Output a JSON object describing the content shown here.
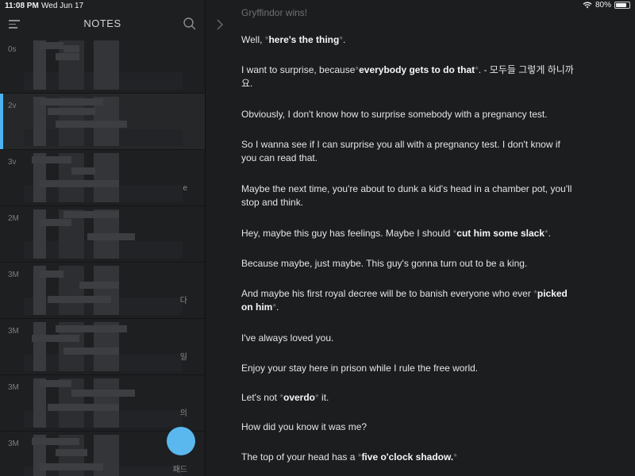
{
  "status": {
    "time": "11:08 PM",
    "date": "Wed Jun 17",
    "battery": "80%",
    "battery_level": 0.8
  },
  "sidebar": {
    "title": "NOTES",
    "items": [
      {
        "meta": "0s",
        "tail": ""
      },
      {
        "meta": "2v",
        "tail": ""
      },
      {
        "meta": "3v",
        "tail": "e"
      },
      {
        "meta": "2M",
        "tail": ""
      },
      {
        "meta": "3M",
        "tail": "다"
      },
      {
        "meta": "3M",
        "tail": "일"
      },
      {
        "meta": "3M",
        "tail": "의"
      },
      {
        "meta": "3M",
        "tail": "패드"
      }
    ]
  },
  "editor": {
    "top_line": "Gryffindor wins!",
    "paragraphs": [
      [
        {
          "t": "Well, "
        },
        {
          "a": "*"
        },
        {
          "b": "here's the thing"
        },
        {
          "a": "*"
        },
        {
          "t": "."
        }
      ],
      [
        {
          "t": "I want to surprise, because"
        },
        {
          "a": "*"
        },
        {
          "b": "everybody gets to do that"
        },
        {
          "a": "*"
        },
        {
          "t": ". - 모두들 그렇게 하니까요."
        }
      ],
      [
        {
          "t": "Obviously, I don't know how to surprise somebody with a pregnancy test."
        }
      ],
      [
        {
          "t": "So I wanna see if I can surprise you all with a pregnancy test. I don't know if you can read that."
        }
      ],
      [
        {
          "t": "Maybe the next time, you're about to dunk a kid's head in a chamber pot, you'll stop and think."
        }
      ],
      [
        {
          "t": "Hey, maybe this guy has feelings. Maybe I should "
        },
        {
          "a": "*"
        },
        {
          "b": "cut him some slack"
        },
        {
          "a": "*"
        },
        {
          "t": "."
        }
      ],
      [
        {
          "t": "Because maybe, just maybe. This guy's gonna turn out to be a king."
        }
      ],
      [
        {
          "t": "And maybe his first royal decree will be to banish everyone who ever "
        },
        {
          "a": "*"
        },
        {
          "b": "picked on him"
        },
        {
          "a": "*"
        },
        {
          "t": "."
        }
      ],
      [
        {
          "t": "I've always loved you."
        }
      ],
      [
        {
          "t": "Enjoy your stay here in prison while I rule the free world."
        }
      ],
      [
        {
          "t": "Let's not "
        },
        {
          "a": "*"
        },
        {
          "b": "overdo"
        },
        {
          "a": "*"
        },
        {
          "t": " it."
        }
      ],
      [
        {
          "t": "How did you know it was me?"
        }
      ],
      [
        {
          "t": "The top of your head has a "
        },
        {
          "a": "*"
        },
        {
          "b": "five o'clock shadow."
        },
        {
          "a": "*"
        }
      ]
    ]
  }
}
